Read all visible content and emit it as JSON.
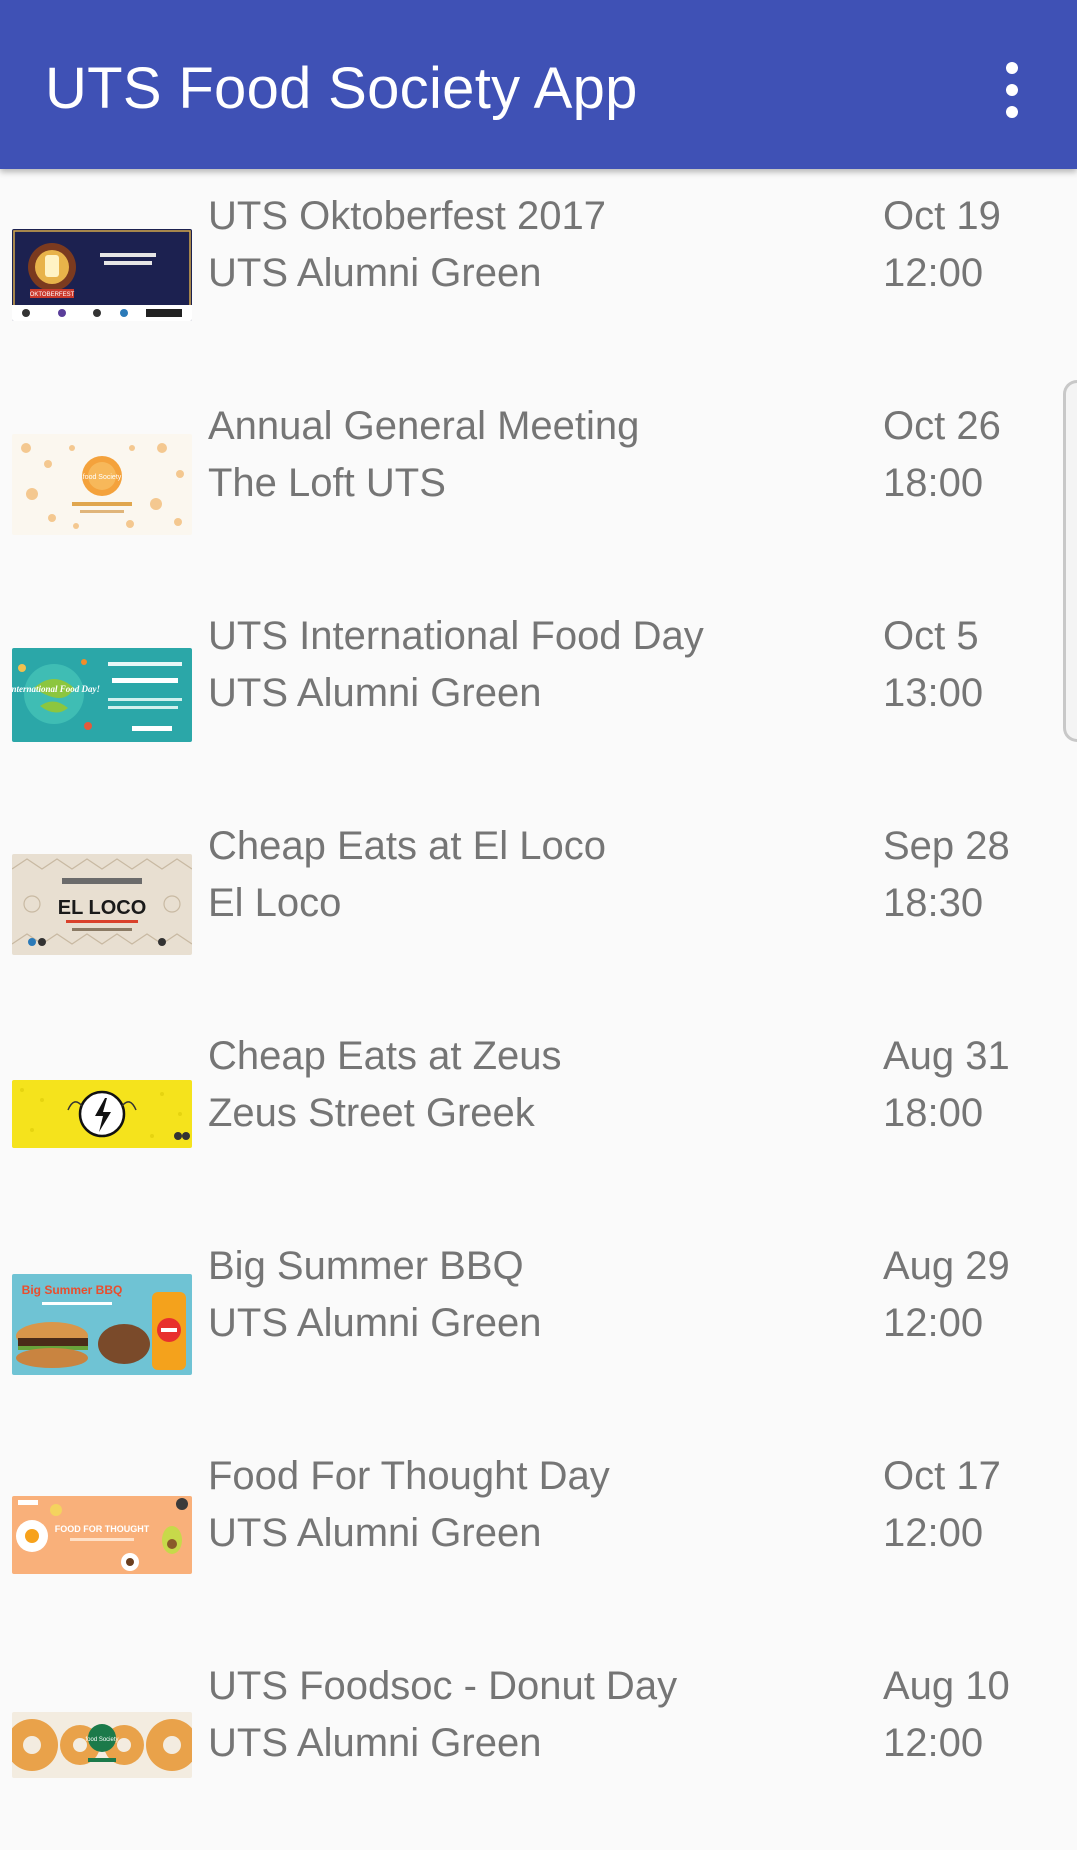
{
  "app": {
    "title": "UTS Food Society App",
    "accent_color": "#3f51b5",
    "overflow_icon": "more-vert-icon"
  },
  "events": [
    {
      "name": "UTS Oktoberfest 2017",
      "location": "UTS Alumni Green",
      "date": "Oct 19",
      "time": "12:00",
      "image": "oktoberfest-banner",
      "image_text": "OKTOBERFEST"
    },
    {
      "name": "Annual General Meeting",
      "location": "The Loft UTS",
      "date": "Oct 26",
      "time": "18:00",
      "image": "agm-banner",
      "image_text": "food Society"
    },
    {
      "name": "UTS International Food Day",
      "location": "UTS Alumni Green",
      "date": "Oct 5",
      "time": "13:00",
      "image": "international-food-day-banner",
      "image_text": "International Food Day!"
    },
    {
      "name": "Cheap Eats at El Loco",
      "location": "El Loco",
      "date": "Sep 28",
      "time": "18:30",
      "image": "el-loco-banner",
      "image_text": "EL LOCO"
    },
    {
      "name": "Cheap Eats at Zeus",
      "location": "Zeus Street Greek",
      "date": "Aug 31",
      "time": "18:00",
      "image": "zeus-banner",
      "image_text": ""
    },
    {
      "name": "Big Summer BBQ",
      "location": "UTS Alumni Green",
      "date": "Aug 29",
      "time": "12:00",
      "image": "bbq-banner",
      "image_text": "Big Summer BBQ"
    },
    {
      "name": "Food For Thought Day",
      "location": "UTS Alumni Green",
      "date": "Oct 17",
      "time": "12:00",
      "image": "food-for-thought-banner",
      "image_text": "FOOD FOR THOUGHT"
    },
    {
      "name": "UTS Foodsoc - Donut Day",
      "location": "UTS Alumni Green",
      "date": "Aug 10",
      "time": "12:00",
      "image": "donut-day-banner",
      "image_text": "food Society"
    }
  ]
}
